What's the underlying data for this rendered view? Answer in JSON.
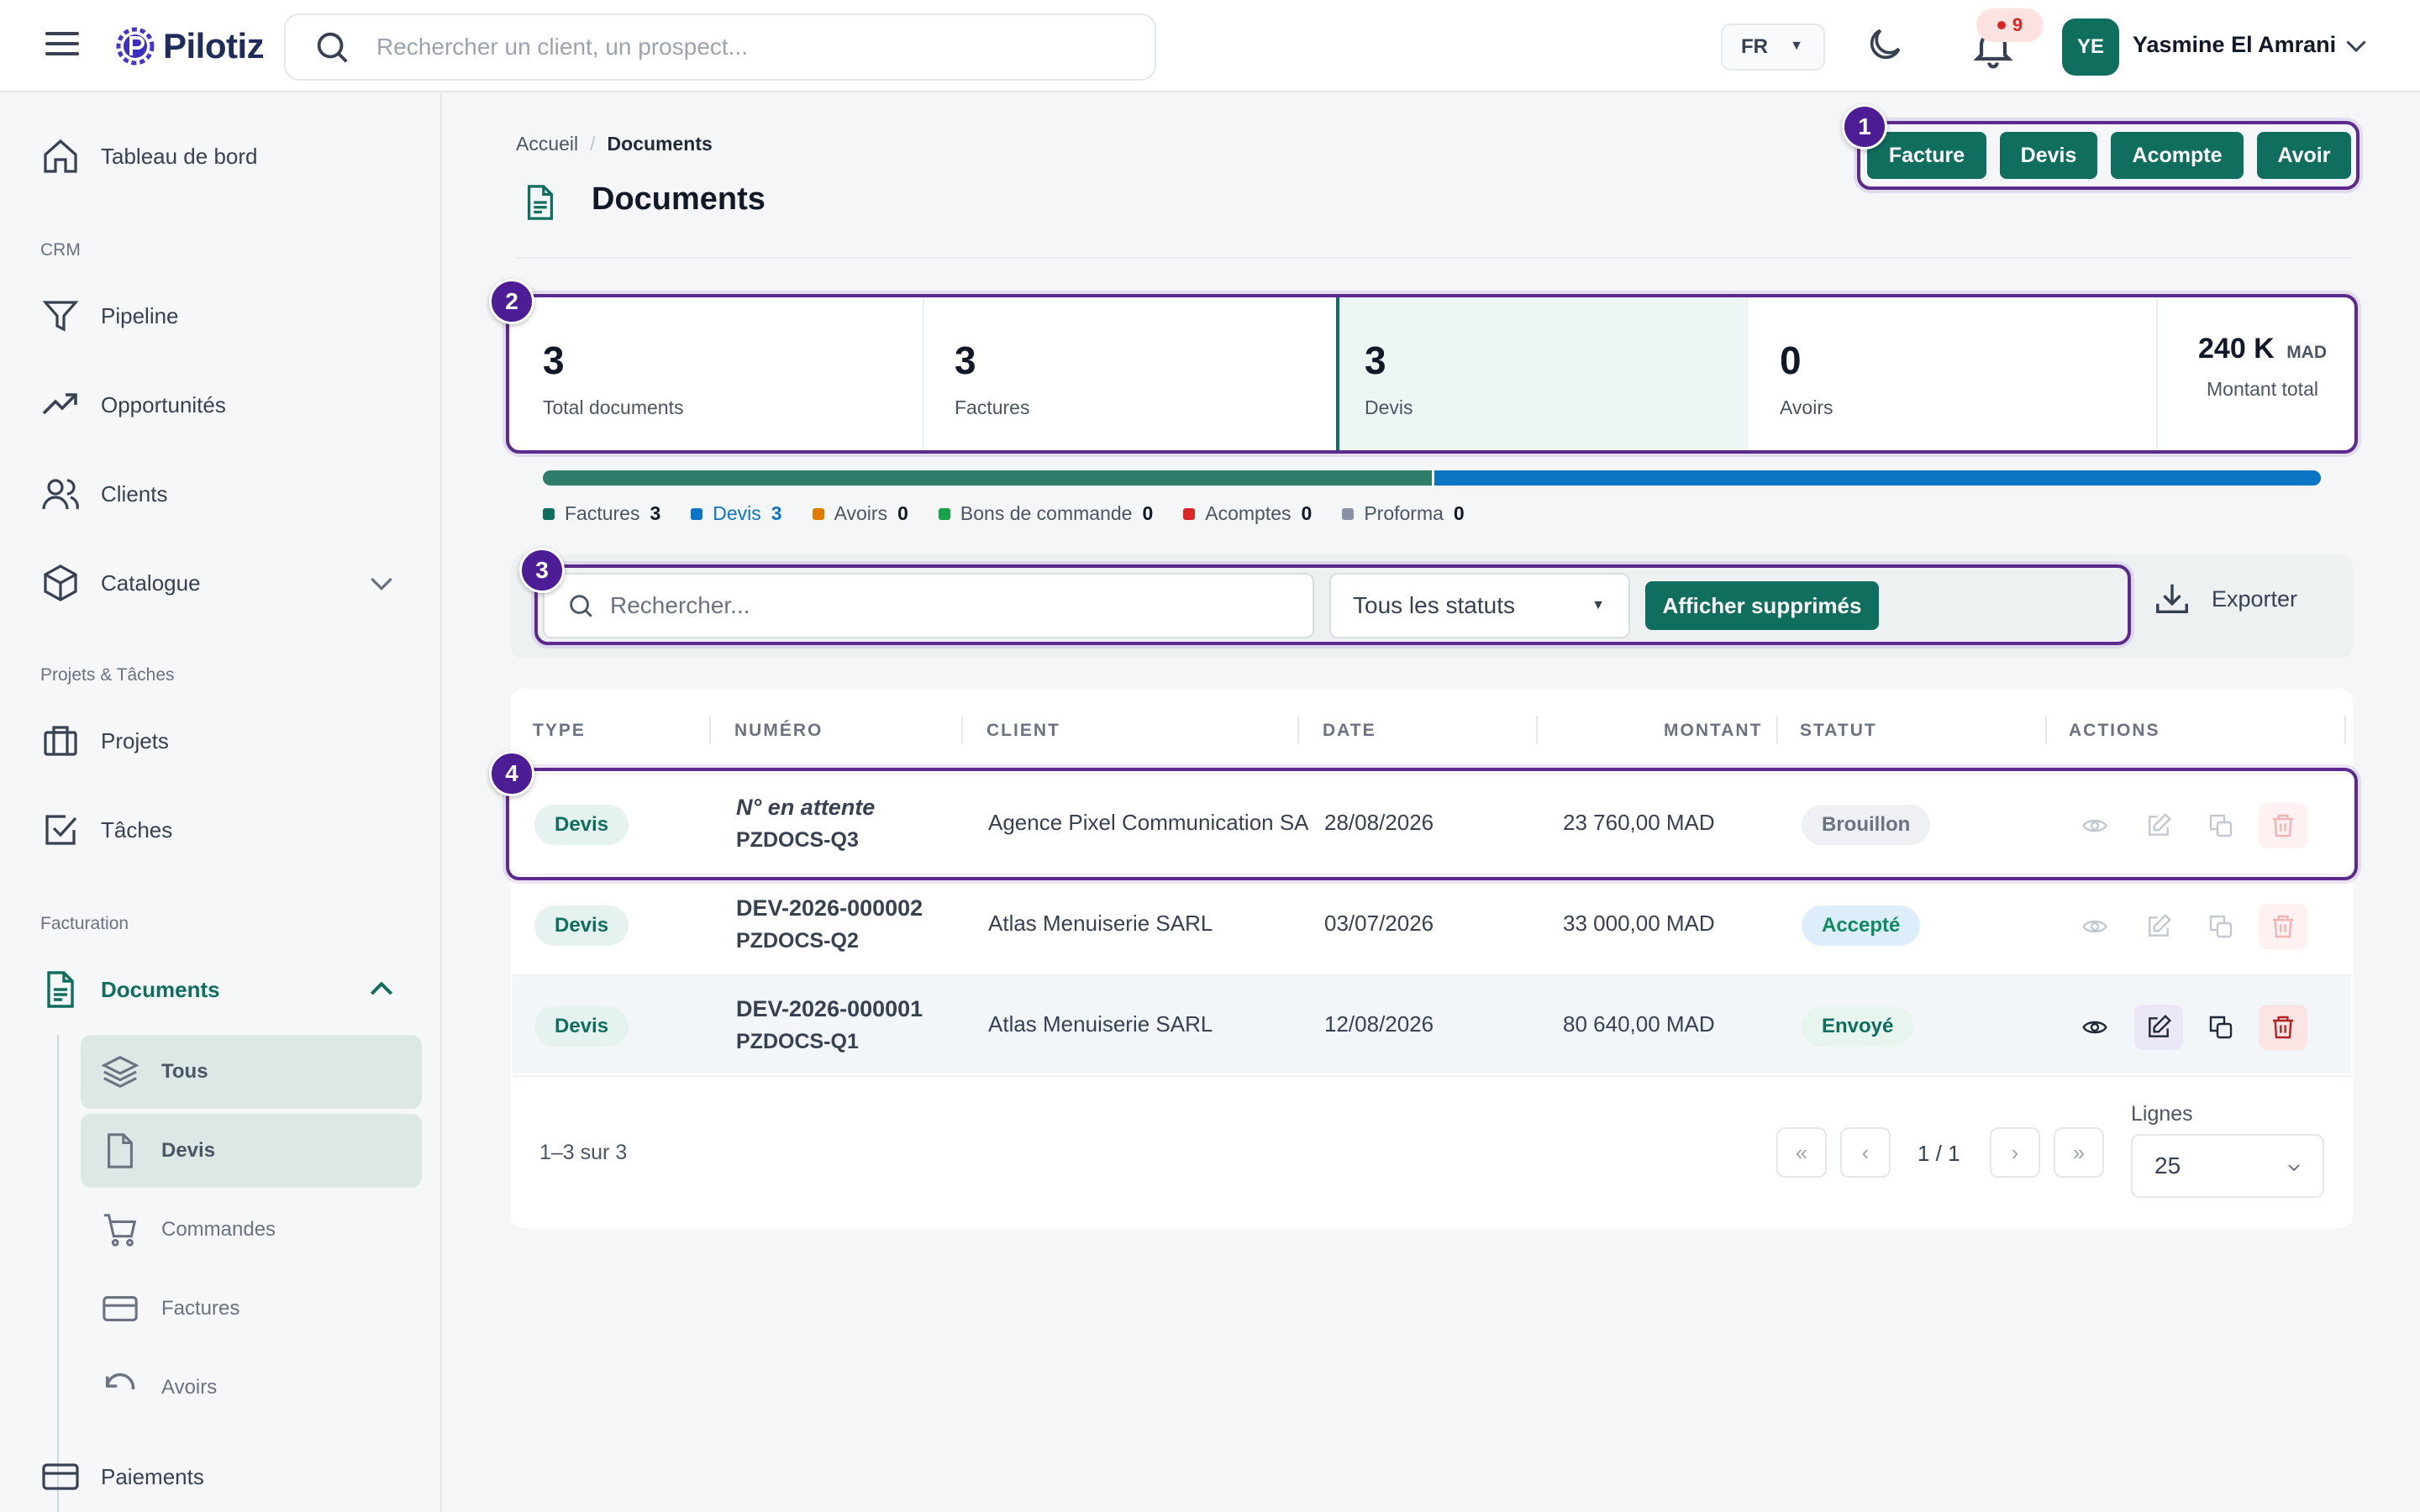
{
  "app": {
    "name": "Pilotiz"
  },
  "header": {
    "search_placeholder": "Rechercher un client, un prospect...",
    "language": "FR",
    "notifications_count": "9",
    "user": {
      "initials": "YE",
      "name": "Yasmine El Amrani"
    }
  },
  "sidebar": {
    "dashboard": "Tableau de bord",
    "section_crm": "CRM",
    "pipeline": "Pipeline",
    "opportunities": "Opportunités",
    "clients": "Clients",
    "catalogue": "Catalogue",
    "section_projects": "Projets & Tâches",
    "projects": "Projets",
    "tasks": "Tâches",
    "section_billing": "Facturation",
    "documents": "Documents",
    "sub": {
      "all": "Tous",
      "quotes": "Devis",
      "orders": "Commandes",
      "invoices": "Factures",
      "credits": "Avoirs"
    },
    "payments": "Paiements"
  },
  "breadcrumb": {
    "home": "Accueil",
    "sep": "/",
    "current": "Documents"
  },
  "page": {
    "title": "Documents"
  },
  "actions": {
    "invoice": "Facture",
    "quote": "Devis",
    "deposit": "Acompte",
    "credit": "Avoir"
  },
  "steps": {
    "one": "1",
    "two": "2",
    "three": "3",
    "four": "4"
  },
  "stats": {
    "total": {
      "value": "3",
      "label": "Total documents"
    },
    "invoices": {
      "value": "3",
      "label": "Factures"
    },
    "quotes": {
      "value": "3",
      "label": "Devis"
    },
    "credits": {
      "value": "0",
      "label": "Avoirs"
    },
    "amount": {
      "value": "240 K",
      "unit": "MAD",
      "label": "Montant total"
    }
  },
  "distribution": {
    "segments": [
      {
        "name": "Factures",
        "count": 3,
        "color": "#2e7d6b"
      },
      {
        "name": "Devis",
        "count": 3,
        "color": "#0b74c4"
      }
    ]
  },
  "legend": [
    {
      "name": "Factures",
      "count": "3",
      "color": "#0f6e5e"
    },
    {
      "name": "Devis",
      "count": "3",
      "color": "#0b74c4"
    },
    {
      "name": "Avoirs",
      "count": "0",
      "color": "#e07b00"
    },
    {
      "name": "Bons de commande",
      "count": "0",
      "color": "#16a34a"
    },
    {
      "name": "Acomptes",
      "count": "0",
      "color": "#dc2626"
    },
    {
      "name": "Proforma",
      "count": "0",
      "color": "#8a93a6"
    }
  ],
  "filters": {
    "search_placeholder": "Rechercher...",
    "status": "Tous les statuts",
    "show_deleted": "Afficher supprimés",
    "export": "Exporter"
  },
  "table": {
    "headers": {
      "type": "TYPE",
      "number": "NUMÉRO",
      "client": "CLIENT",
      "date": "DATE",
      "amount": "MONTANT",
      "status": "STATUT",
      "actions": "ACTIONS"
    },
    "rows": [
      {
        "type": "Devis",
        "number": "N° en attente",
        "ref": "PZDOCS-Q3",
        "client": "Agence Pixel Communication SA",
        "date": "28/08/2026",
        "amount": "23 760,00 MAD",
        "status": "Brouillon"
      },
      {
        "type": "Devis",
        "number": "DEV-2026-000002",
        "ref": "PZDOCS-Q2",
        "client": "Atlas Menuiserie SARL",
        "date": "03/07/2026",
        "amount": "33 000,00 MAD",
        "status": "Accepté"
      },
      {
        "type": "Devis",
        "number": "DEV-2026-000001",
        "ref": "PZDOCS-Q1",
        "client": "Atlas Menuiserie SARL",
        "date": "12/08/2026",
        "amount": "80 640,00 MAD",
        "status": "Envoyé"
      }
    ]
  },
  "pagination": {
    "range": "1–3 sur 3",
    "first": "«",
    "prev": "‹",
    "next": "›",
    "last": "»",
    "page": "1 / 1",
    "lines_label": "Lignes",
    "lines_value": "25"
  }
}
